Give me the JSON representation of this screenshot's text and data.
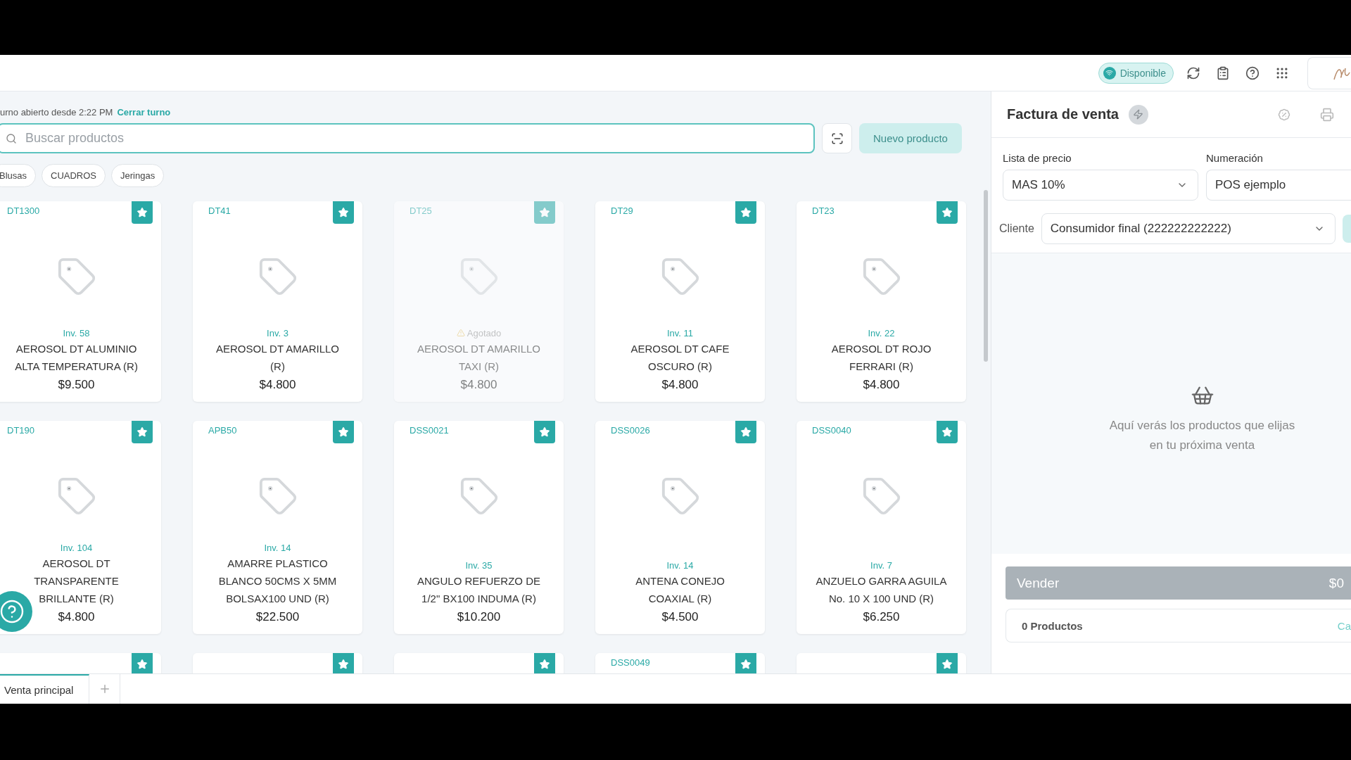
{
  "topbar": {
    "status": {
      "label": "Disponible",
      "online": true
    }
  },
  "shift": {
    "text": "urno abierto desde 2:22 PM",
    "action": "Cerrar turno"
  },
  "search": {
    "placeholder": "Buscar productos"
  },
  "new_product_button": "Nuevo producto",
  "categories": [
    "Blusas",
    "CUADROS",
    "Jeringas"
  ],
  "products": [
    {
      "code": "DT1300",
      "stock": "Inv. 58",
      "name": "AEROSOL DT ALUMINIO ALTA TEMPERATURA (R)",
      "price": "$9.500",
      "out_of_stock": false,
      "favorite": true
    },
    {
      "code": "DT41",
      "stock": "Inv. 3",
      "name": "AEROSOL DT AMARILLO (R)",
      "price": "$4.800",
      "out_of_stock": false,
      "favorite": true
    },
    {
      "code": "DT25",
      "stock": "Agotado",
      "name": "AEROSOL DT AMARILLO TAXI (R)",
      "price": "$4.800",
      "out_of_stock": true,
      "favorite": true
    },
    {
      "code": "DT29",
      "stock": "Inv. 11",
      "name": "AEROSOL DT CAFE OSCURO (R)",
      "price": "$4.800",
      "out_of_stock": false,
      "favorite": true
    },
    {
      "code": "DT23",
      "stock": "Inv. 22",
      "name": "AEROSOL DT ROJO FERRARI (R)",
      "price": "$4.800",
      "out_of_stock": false,
      "favorite": true
    },
    {
      "code": "DT190",
      "stock": "Inv. 104",
      "name": "AEROSOL DT TRANSPARENTE BRILLANTE (R)",
      "price": "$4.800",
      "out_of_stock": false,
      "favorite": true
    },
    {
      "code": "APB50",
      "stock": "Inv. 14",
      "name": "AMARRE PLASTICO BLANCO 50CMS X 5MM BOLSAX100 UND (R)",
      "price": "$22.500",
      "out_of_stock": false,
      "favorite": true
    },
    {
      "code": "DSS0021",
      "stock": "Inv. 35",
      "name": "ANGULO REFUERZO DE 1/2\" BX100 INDUMA (R)",
      "price": "$10.200",
      "out_of_stock": false,
      "favorite": true
    },
    {
      "code": "DSS0026",
      "stock": "Inv. 14",
      "name": "ANTENA CONEJO COAXIAL (R)",
      "price": "$4.500",
      "out_of_stock": false,
      "favorite": true
    },
    {
      "code": "DSS0040",
      "stock": "Inv. 7",
      "name": "ANZUELO GARRA AGUILA No. 10 X 100 UND (R)",
      "price": "$6.250",
      "out_of_stock": false,
      "favorite": true
    }
  ],
  "products_partial": [
    {
      "favorite": true
    },
    {
      "favorite": true
    },
    {
      "favorite": true
    },
    {
      "code": "DSS0049",
      "favorite": true
    },
    {
      "favorite": true
    }
  ],
  "invoice": {
    "title": "Factura de venta",
    "price_list": {
      "label": "Lista de precio",
      "value": "MAS 10%"
    },
    "numbering": {
      "label": "Numeración",
      "value": "POS ejemplo"
    },
    "client": {
      "label": "Cliente",
      "value": "Consumidor final (222222222222)"
    },
    "empty_message": "Aquí verás los productos que elijas en tu próxima venta",
    "sell_button": {
      "label": "Vender",
      "total": "$0",
      "disabled": true
    },
    "summary": {
      "count": "0 Productos",
      "action": "Ca"
    }
  },
  "tabs": [
    {
      "label": "Venta principal",
      "selected": true
    }
  ]
}
